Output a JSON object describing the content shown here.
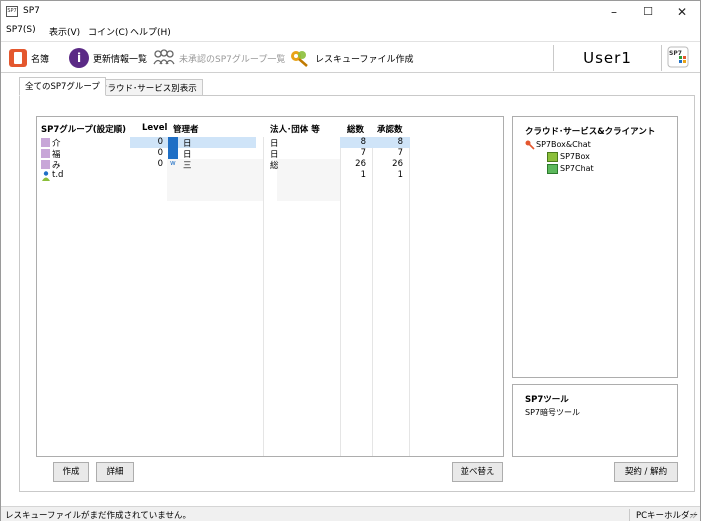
{
  "window": {
    "title": "SP7",
    "minimize": "–",
    "maximize": "☐",
    "close": "✕",
    "app_icon_text": "SP7"
  },
  "menu": {
    "items": [
      "SP7(S)",
      "表示(V)",
      "コイン(C)",
      "ヘルプ(H)"
    ]
  },
  "toolbar": {
    "meishi_label": "名簿",
    "update_label": "更新情報一覧",
    "unapproved_label": "未承認のSP7グループ一覧",
    "rescue_label": "レスキューファイル作成",
    "user_name": "User1",
    "logo_text": "SP7"
  },
  "tabs": [
    "全てのSP7グループ",
    "クラウド･サービス別表示"
  ],
  "groups": {
    "headers": {
      "name": "SP7グループ(設定順)",
      "level": "Level",
      "admin": "管理者",
      "corp": "法人･団体 等",
      "total": "総数",
      "approved": "承認数"
    },
    "rows": [
      {
        "name": "介",
        "level": "0",
        "admin": "日",
        "corp": "日",
        "total": "8",
        "approved": "8"
      },
      {
        "name": "福",
        "level": "0",
        "admin": "日",
        "corp": "日",
        "total": "7",
        "approved": "7"
      },
      {
        "name": "み",
        "level": "0",
        "admin": "三",
        "corp": "総",
        "total": "26",
        "approved": "26"
      },
      {
        "name": "t.d",
        "level": "",
        "admin": "",
        "corp": "",
        "total": "1",
        "approved": "1"
      }
    ]
  },
  "buttons": {
    "create": "作成",
    "detail": "詳細",
    "sort": "並べ替え",
    "contract": "契約 / 解約"
  },
  "cloud": {
    "title": "クラウド･サービス&クライアント",
    "root": "SP7Box&Chat",
    "children": [
      "SP7Box",
      "SP7Chat"
    ]
  },
  "tools": {
    "title": "SP7ツール",
    "items": [
      "SP7暗号ツール"
    ]
  },
  "status": {
    "message": "レスキューファイルがまだ作成されていません。",
    "right": "PCキーホルダー"
  },
  "colors": {
    "accent_blue": "#1f6fc5",
    "selection": "#cfe4f8",
    "meishi_orange": "#e4572e",
    "info_purple": "#5b2a86"
  }
}
